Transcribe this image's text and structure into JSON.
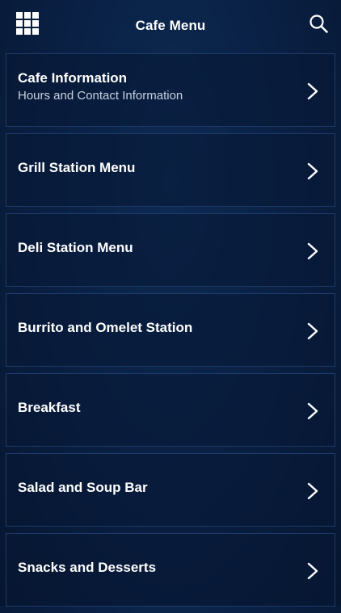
{
  "header": {
    "title": "Cafe Menu"
  },
  "icons": {
    "left": "grid-icon",
    "right": "search-icon",
    "row": "chevron-right-icon"
  },
  "colors": {
    "background": "#0a2145",
    "item_border": "#1d3b6a",
    "text": "#ffffff",
    "subtitle": "#c9d2e0"
  },
  "menu": {
    "items": [
      {
        "title": "Cafe Information",
        "subtitle": "Hours and Contact Information"
      },
      {
        "title": "Grill Station Menu"
      },
      {
        "title": "Deli Station Menu"
      },
      {
        "title": "Burrito and Omelet Station"
      },
      {
        "title": "Breakfast"
      },
      {
        "title": "Salad and Soup Bar"
      },
      {
        "title": "Snacks and Desserts"
      }
    ]
  }
}
